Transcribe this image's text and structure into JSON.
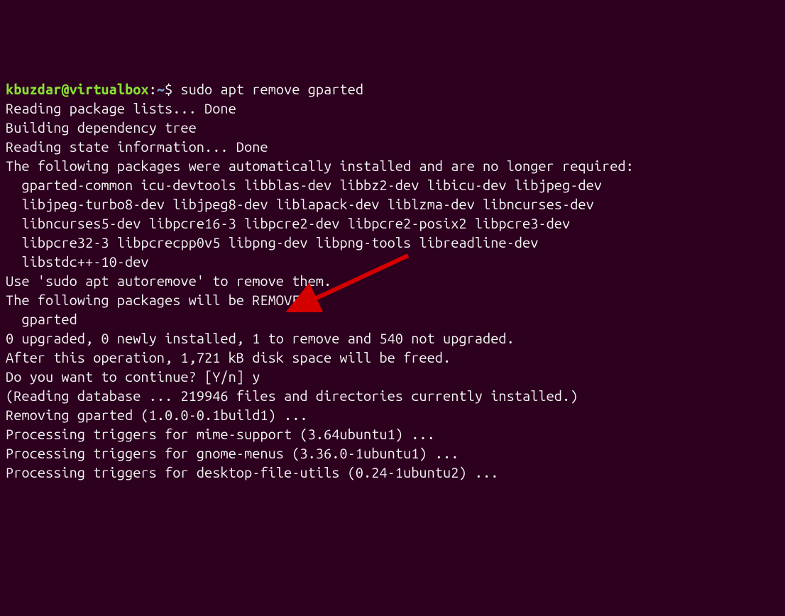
{
  "prompt": {
    "user": "kbuzdar",
    "at": "@",
    "host": "virtualbox",
    "colon": ":",
    "path": "~",
    "dollar": "$ ",
    "command": "sudo apt remove gparted"
  },
  "lines": {
    "l1": "Reading package lists... Done",
    "l2": "Building dependency tree",
    "l3": "Reading state information... Done",
    "l4": "The following packages were automatically installed and are no longer required:",
    "l5": "  gparted-common icu-devtools libblas-dev libbz2-dev libicu-dev libjpeg-dev",
    "l6": "  libjpeg-turbo8-dev libjpeg8-dev liblapack-dev liblzma-dev libncurses-dev",
    "l7": "  libncurses5-dev libpcre16-3 libpcre2-dev libpcre2-posix2 libpcre3-dev",
    "l8": "  libpcre32-3 libpcrecpp0v5 libpng-dev libpng-tools libreadline-dev",
    "l9": "  libstdc++-10-dev",
    "l10": "Use 'sudo apt autoremove' to remove them.",
    "l11": "The following packages will be REMOVED:",
    "l12": "  gparted",
    "l13": "0 upgraded, 0 newly installed, 1 to remove and 540 not upgraded.",
    "l14": "After this operation, 1,721 kB disk space will be freed.",
    "l15": "Do you want to continue? [Y/n] y",
    "l16": "(Reading database ... 219946 files and directories currently installed.)",
    "l17": "Removing gparted (1.0.0-0.1build1) ...",
    "l18": "Processing triggers for mime-support (3.64ubuntu1) ...",
    "l19": "Processing triggers for gnome-menus (3.36.0-1ubuntu1) ...",
    "l20": "Processing triggers for desktop-file-utils (0.24-1ubuntu2) ..."
  },
  "annotation": {
    "arrow_color": "#d40000"
  }
}
